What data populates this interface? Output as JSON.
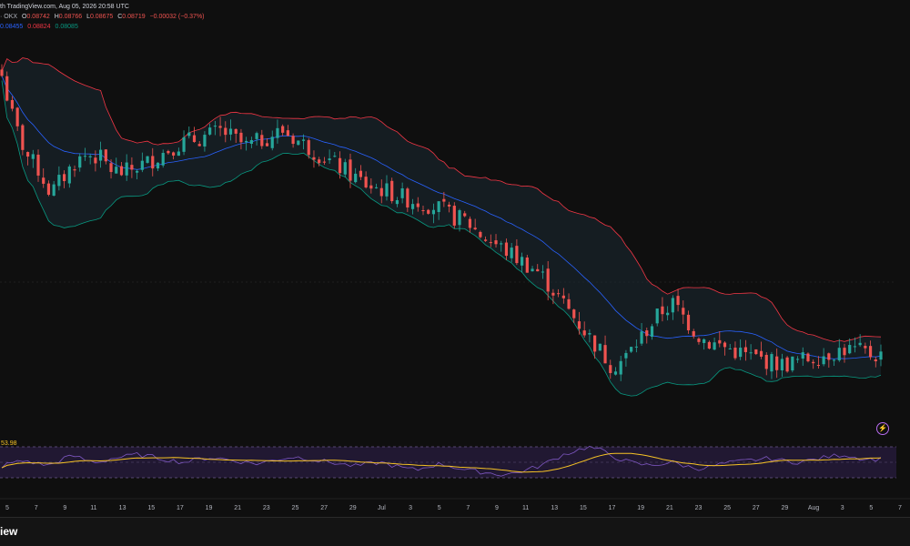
{
  "header": {
    "published_text": "th TradingView.com, Aug 05, 2026 20:58 UTC"
  },
  "legend": {
    "symbol_suffix": "· OKX",
    "ohlc": {
      "o_label": "O",
      "o": "0.08742",
      "h_label": "H",
      "h": "0.08766",
      "l_label": "L",
      "l": "0.08675",
      "c_label": "C",
      "c": "0.08719",
      "change": "−0.00032 (−0.37%)"
    },
    "bb": {
      "basis": "0.08455",
      "upper": "0.08824",
      "lower": "0.08085"
    }
  },
  "rsi": {
    "value_label": "53.98"
  },
  "footer": {
    "brand_text": "iew"
  },
  "colors": {
    "background": "#0f0f0f",
    "up": "#26a69a",
    "down": "#ef5350",
    "bb_basis": "#2962ff",
    "bb_upper": "#f23645",
    "bb_lower": "#089981",
    "bb_fill": "#1b2a33",
    "rsi_line": "#7e57c2",
    "rsi_ma": "#f7c325",
    "rsi_band": "#2a1d42",
    "text": "#b2b5be"
  },
  "icons": {
    "alert": "lightning-bolt-icon"
  },
  "chart_data": {
    "type": "candlestick",
    "x_ticks": [
      "5",
      "7",
      "9",
      "11",
      "13",
      "15",
      "17",
      "19",
      "21",
      "23",
      "25",
      "27",
      "29",
      "Jul",
      "3",
      "5",
      "7",
      "9",
      "11",
      "13",
      "15",
      "17",
      "19",
      "21",
      "23",
      "25",
      "27",
      "29",
      "Aug",
      "3",
      "5",
      "7"
    ],
    "close_path": [
      0.105,
      0.102,
      0.1,
      0.099,
      0.0975,
      0.0985,
      0.0995,
      0.1,
      0.0998,
      0.099,
      0.0988,
      0.0992,
      0.0995,
      0.1,
      0.1005,
      0.1008,
      0.101,
      0.1012,
      0.1015,
      0.101,
      0.1005,
      0.1008,
      0.1012,
      0.1015,
      0.101,
      0.1005,
      0.1,
      0.0995,
      0.099,
      0.0985,
      0.098,
      0.0978,
      0.0975,
      0.0972,
      0.097,
      0.0968,
      0.0965,
      0.096,
      0.0958,
      0.095,
      0.0945,
      0.094,
      0.0935,
      0.093,
      0.0925,
      0.0915,
      0.0905,
      0.0895,
      0.0885,
      0.0875,
      0.0865,
      0.087,
      0.088,
      0.089,
      0.09,
      0.0905,
      0.0895,
      0.0885,
      0.088,
      0.0878,
      0.0875,
      0.0872,
      0.087,
      0.0868,
      0.0866,
      0.0868,
      0.087,
      0.0872,
      0.0874,
      0.0876,
      0.0875,
      0.0873,
      0.0872
    ],
    "rsi": [
      45,
      50,
      52,
      48,
      46,
      55,
      58,
      52,
      50,
      55,
      57,
      60,
      58,
      55,
      52,
      50,
      54,
      56,
      55,
      52,
      50,
      48,
      52,
      55,
      57,
      55,
      52,
      50,
      47,
      45,
      48,
      50,
      46,
      42,
      40,
      45,
      48,
      44,
      40,
      38,
      36,
      34,
      36,
      40,
      45,
      52,
      60,
      65,
      70,
      66,
      58,
      52,
      48,
      46,
      48,
      50,
      45,
      42,
      44,
      48,
      50,
      52,
      54,
      55,
      52,
      50,
      52,
      55,
      58,
      60,
      56,
      54,
      54
    ]
  }
}
